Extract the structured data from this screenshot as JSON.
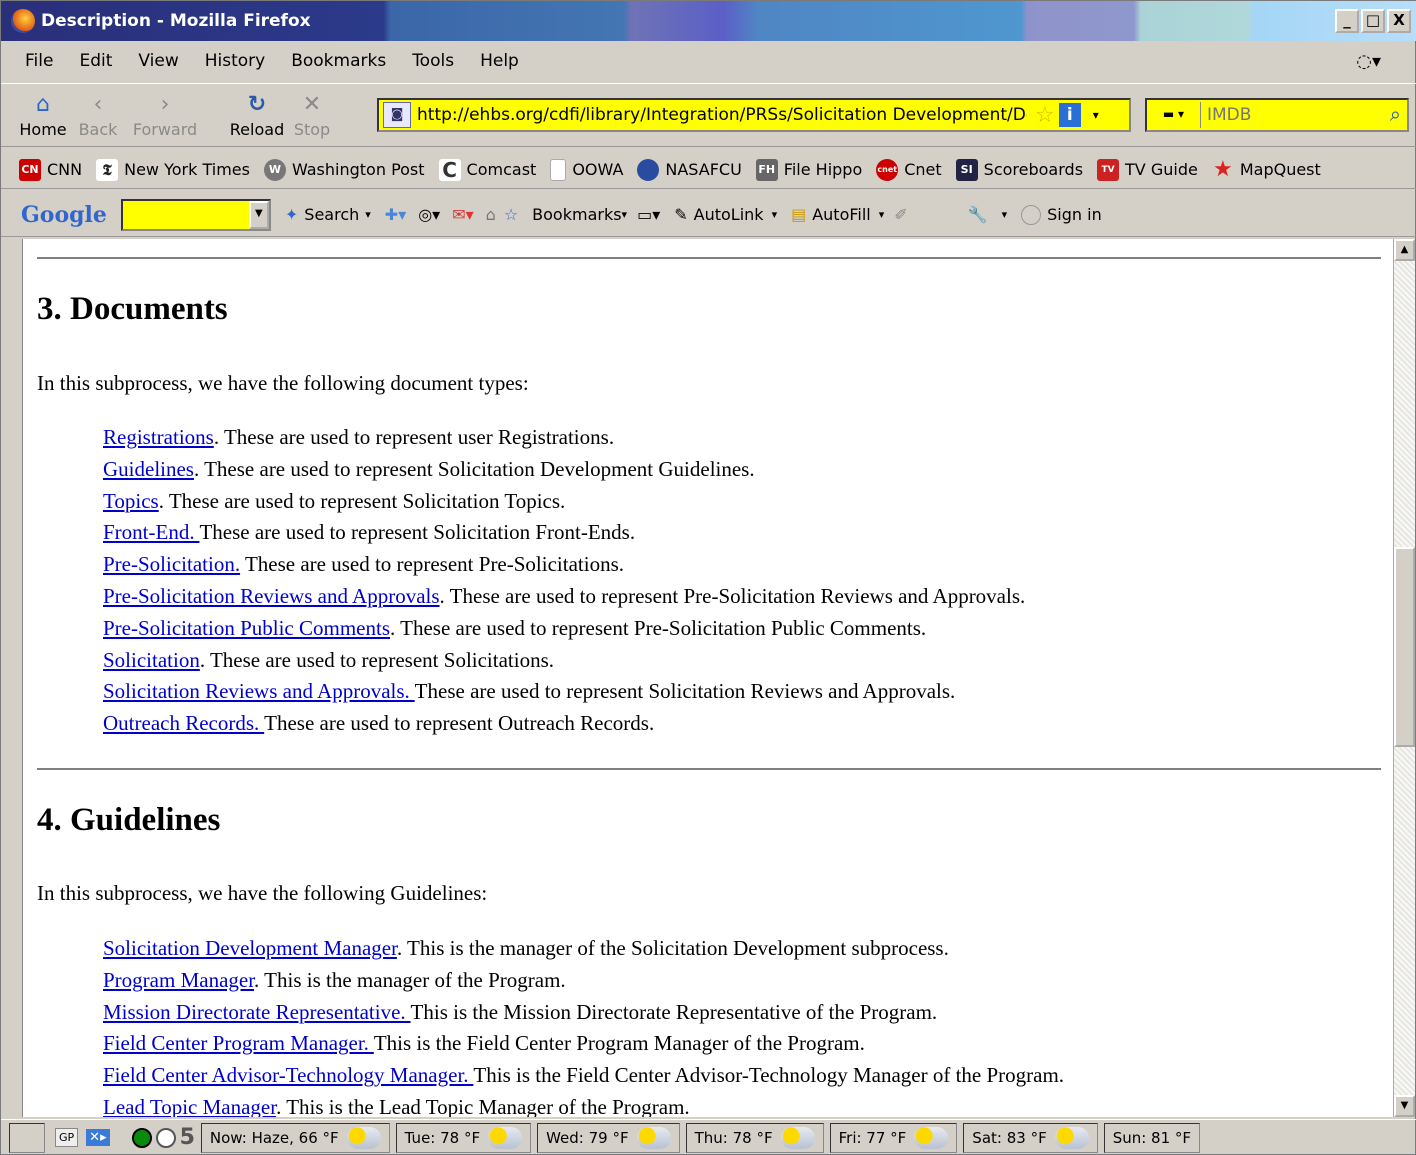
{
  "window": {
    "title": "Description - Mozilla Firefox",
    "buttons": [
      "_",
      "□",
      "X"
    ]
  },
  "menu": [
    "File",
    "Edit",
    "View",
    "History",
    "Bookmarks",
    "Tools",
    "Help"
  ],
  "nav": {
    "home": "Home",
    "back": "Back",
    "forward": "Forward",
    "reload": "Reload",
    "stop": "Stop"
  },
  "url": "http://ehbs.org/cdfi/library/Integration/PRSs/Solicitation Development/Descr",
  "search": {
    "placeholder": "IMDB"
  },
  "bookmarks": [
    {
      "label": "CNN",
      "icon": "cnn-icon",
      "color": "#cc0000"
    },
    {
      "label": "New York Times",
      "icon": "nyt-icon",
      "color": "#222222"
    },
    {
      "label": "Washington Post",
      "icon": "wapo-icon",
      "color": "#555555"
    },
    {
      "label": "Comcast",
      "icon": "comcast-icon",
      "color": "#333333"
    },
    {
      "label": "OOWA",
      "icon": "page-icon",
      "color": "#bbbbbb"
    },
    {
      "label": "NASAFCU",
      "icon": "nasafcu-icon",
      "color": "#2a4ca0"
    },
    {
      "label": "File Hippo",
      "icon": "filehippo-icon",
      "color": "#666666"
    },
    {
      "label": "Cnet",
      "icon": "cnet-icon",
      "color": "#cc0000"
    },
    {
      "label": "Scoreboards",
      "icon": "si-icon",
      "color": "#222244"
    },
    {
      "label": "TV Guide",
      "icon": "tvguide-icon",
      "color": "#cc2222"
    },
    {
      "label": "MapQuest",
      "icon": "mapquest-icon",
      "color": "#dd2222"
    }
  ],
  "google_toolbar": {
    "logo": "Google",
    "search": "Search",
    "bookmarks": "Bookmarks",
    "autolink": "AutoLink",
    "autofill": "AutoFill",
    "signin": "Sign in"
  },
  "content": {
    "section3": {
      "heading": "3. Documents",
      "intro": "In this subprocess, we have the following document types:",
      "items": [
        {
          "link": "Registrations",
          "text": ". These are used to represent user Registrations."
        },
        {
          "link": "Guidelines",
          "text": ". These are used to represent Solicitation Development Guidelines."
        },
        {
          "link": "Topics",
          "text": ". These are used to represent Solicitation Topics."
        },
        {
          "link": "Front-End. ",
          "text": "These are used to represent Solicitation Front-Ends."
        },
        {
          "link": "Pre-Solicitation.",
          "text": " These are used to represent Pre-Solicitations."
        },
        {
          "link": "Pre-Solicitation Reviews and Approvals",
          "text": ". These are used to represent Pre-Solicitation Reviews and Approvals."
        },
        {
          "link": "Pre-Solicitation Public Comments",
          "text": ". These are used to represent Pre-Solicitation Public Comments."
        },
        {
          "link": "Solicitation",
          "text": ". These are used to represent Solicitations."
        },
        {
          "link": "Solicitation Reviews and Approvals. ",
          "text": "These are used to represent Solicitation Reviews and Approvals."
        },
        {
          "link": "Outreach Records. ",
          "text": "These are used to represent Outreach Records."
        }
      ]
    },
    "section4": {
      "heading": "4. Guidelines",
      "intro": "In this subprocess, we have the following Guidelines:",
      "items": [
        {
          "link": "Solicitation Development Manager",
          "text": ". This is the manager of the Solicitation Development subprocess."
        },
        {
          "link": "Program Manager",
          "text": ". This is the manager of the Program."
        },
        {
          "link": "Mission Directorate Representative. ",
          "text": "This is the Mission Directorate Representative of the Program."
        },
        {
          "link": "Field Center Program Manager. ",
          "text": "This is the Field Center Program Manager of the Program."
        },
        {
          "link": "Field Center Advisor-Technology Manager. ",
          "text": "This is the Field Center Advisor-Technology Manager of the Program."
        },
        {
          "link": "Lead Topic Manager",
          "text": ". This is the Lead Topic Manager of the Program."
        }
      ]
    }
  },
  "status": {
    "gp": "GP",
    "count": "5",
    "weather": [
      "Now: Haze, 66 °F",
      "Tue: 78 °F",
      "Wed: 79 °F",
      "Thu: 78 °F",
      "Fri: 77 °F",
      "Sat: 83 °F",
      "Sun: 81 °F"
    ]
  }
}
